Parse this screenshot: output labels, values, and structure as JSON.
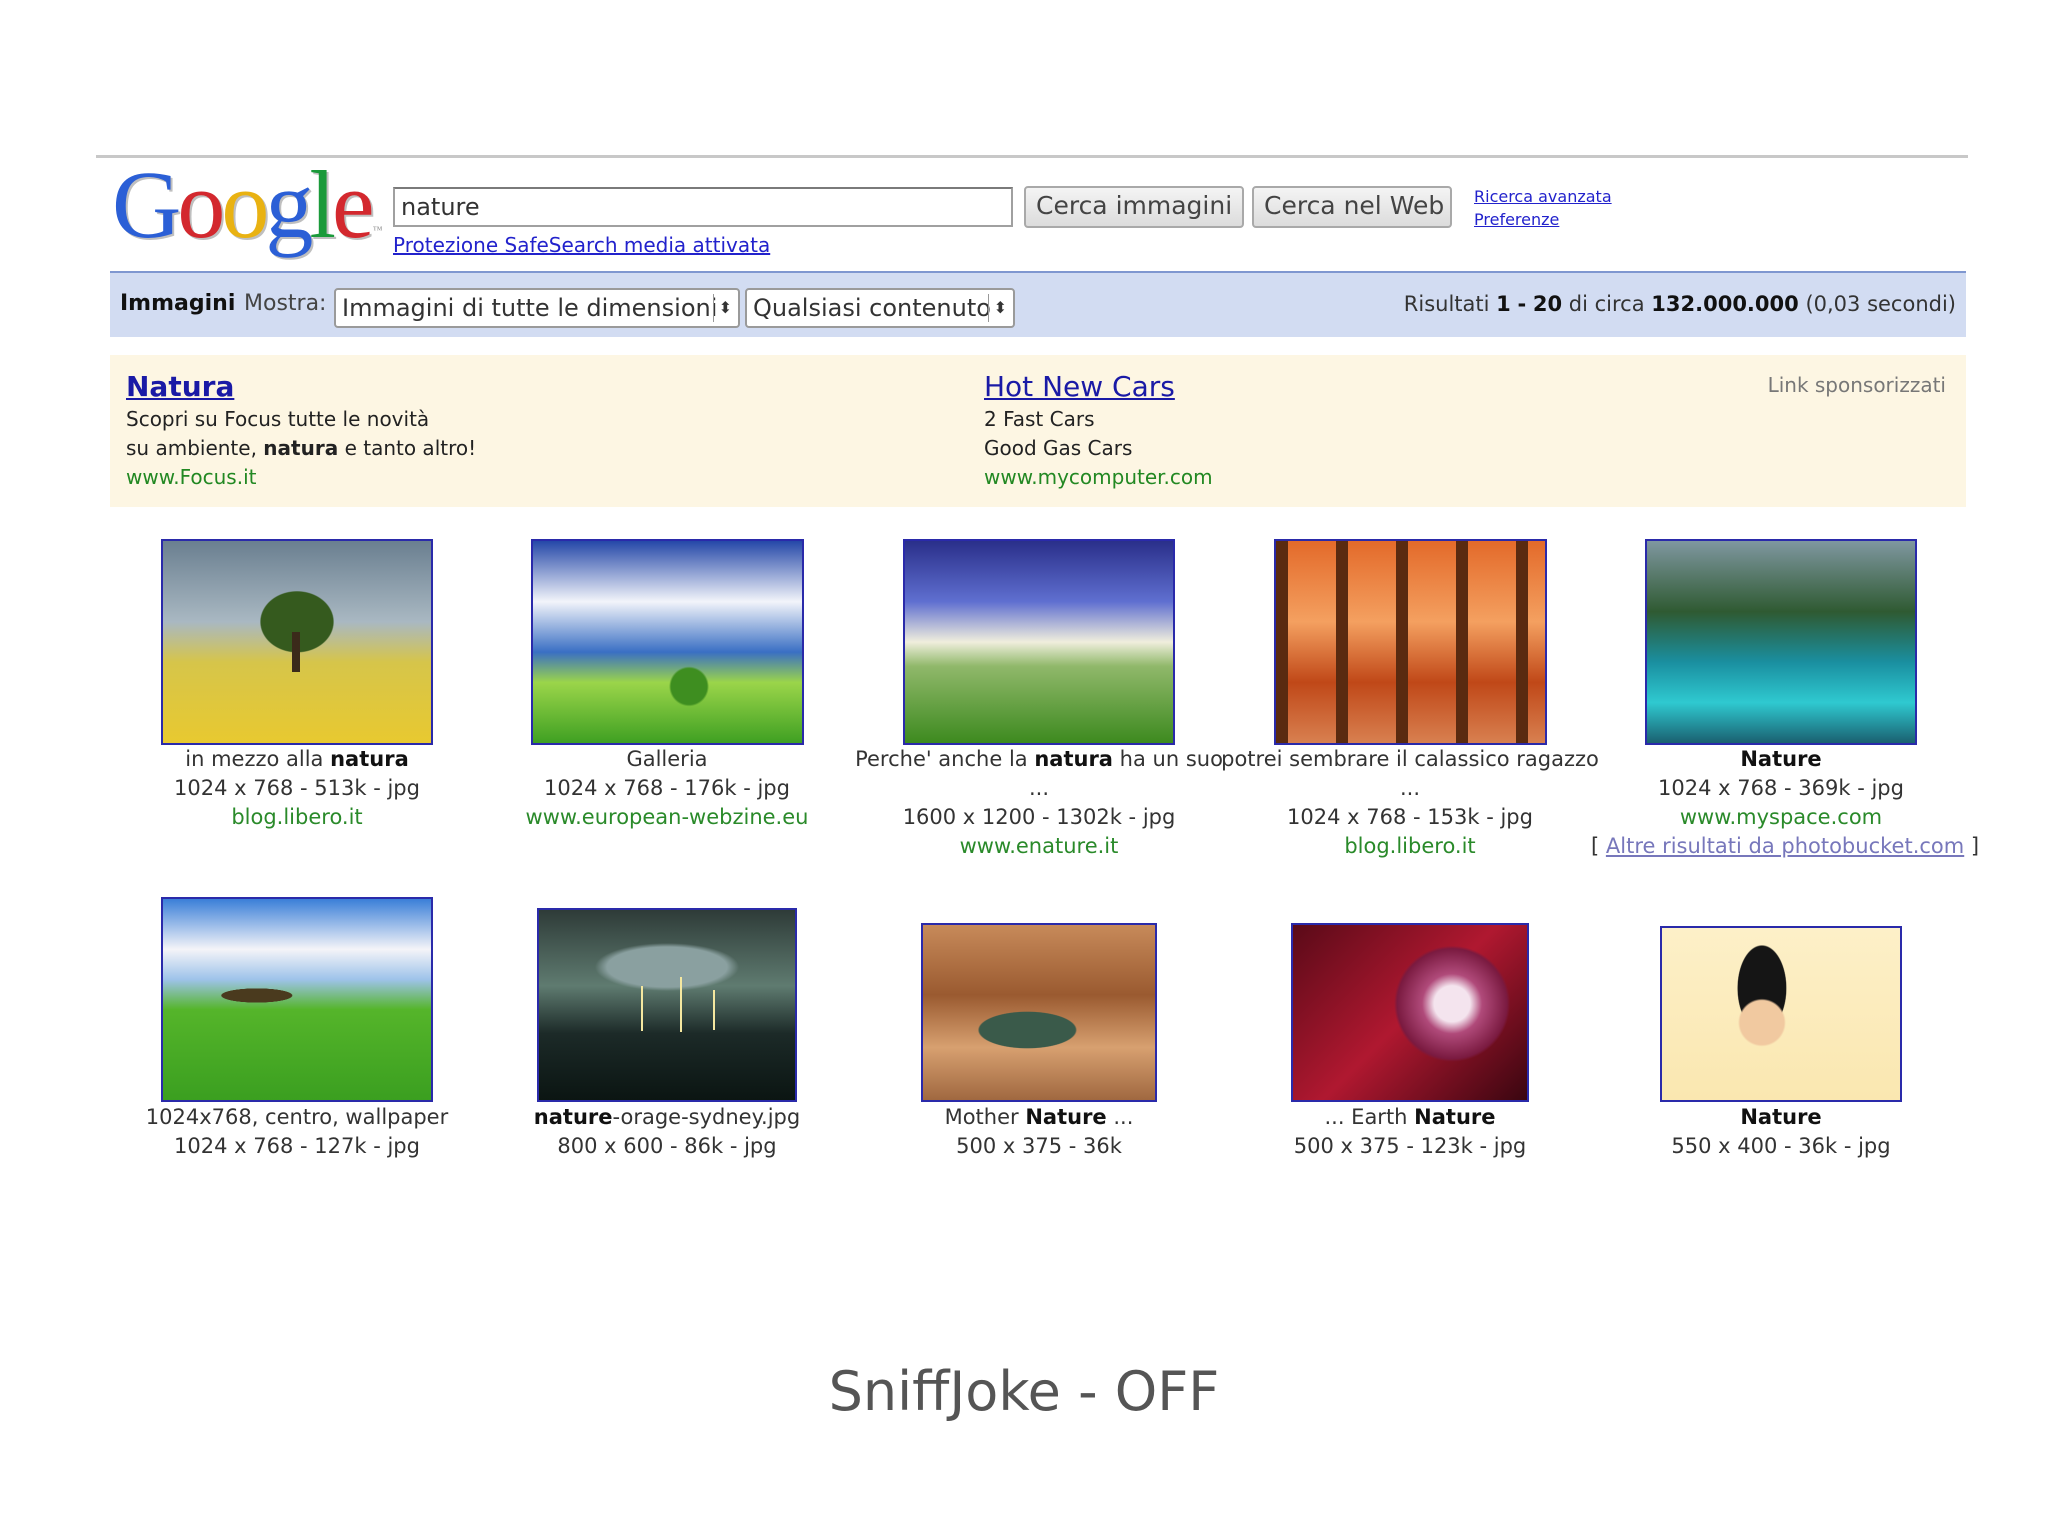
{
  "header": {
    "logo_text": "Google",
    "logo_tm": "™",
    "search_value": "nature",
    "btn_images": "Cerca immagini",
    "btn_web": "Cerca nel Web",
    "advanced_search": "Ricerca avanzata",
    "preferences": "Preferenze",
    "safesearch": "Protezione SafeSearch media attivata"
  },
  "bar": {
    "section": "Immagini",
    "show_label": "Mostra:",
    "size_select": "Immagini di tutte le dimensioni",
    "content_select": "Qualsiasi contenuto",
    "results_prefix": "Risultati",
    "results_from": "1",
    "results_dash": "-",
    "results_to": "20",
    "results_about": "di circa",
    "results_total": "132.000.000",
    "results_time": "(0,03 secondi)"
  },
  "ads": {
    "sponsored_label": "Link sponsorizzati",
    "left": {
      "title": "Natura",
      "line1": "Scopri su Focus tutte le novità",
      "line2_pre": "su ambiente,",
      "line2_bold": "natura",
      "line2_post": "e tanto altro!",
      "url": "www.Focus.it"
    },
    "right": {
      "title": "Hot New Cars",
      "line1": "2 Fast Cars",
      "line2": "Good Gas Cars",
      "url": "www.mycomputer.com"
    }
  },
  "results": [
    {
      "cap_pre": "in mezzo alla",
      "cap_bold": "natura",
      "cap_post": "",
      "cap2": "",
      "meta": "1024 x 768 - 513k - jpg",
      "url": "blog.libero.it"
    },
    {
      "cap_pre": "Galleria",
      "cap_bold": "",
      "cap_post": "",
      "cap2": "",
      "meta": "1024 x 768 - 176k - jpg",
      "url": "www.european-webzine.eu"
    },
    {
      "cap_pre": "Perche' anche la",
      "cap_bold": "natura",
      "cap_post": "ha un suo",
      "cap2": "...",
      "meta": "1600 x 1200 - 1302k - jpg",
      "url": "www.enature.it"
    },
    {
      "cap_pre": "potrei sembrare il calassico ragazzo",
      "cap_bold": "",
      "cap_post": "",
      "cap2": "...",
      "meta": "1024 x 768 - 153k - jpg",
      "url": "blog.libero.it"
    },
    {
      "cap_pre": "",
      "cap_bold": "Nature",
      "cap_post": "",
      "cap2": "",
      "meta": "1024 x 768 - 369k - jpg",
      "url": "www.myspace.com",
      "more_open": "[",
      "more": "Altre risultati da photobucket.com",
      "more_close": "]"
    },
    {
      "cap_pre": "1024x768, centro, wallpaper",
      "cap_bold": "",
      "cap_post": "",
      "meta": "1024 x 768 - 127k - jpg"
    },
    {
      "cap_pre": "",
      "cap_bold": "nature",
      "cap_post": "-orage-sydney.jpg",
      "meta": "800 x 600 - 86k - jpg"
    },
    {
      "cap_pre": "Mother",
      "cap_bold": "Nature",
      "cap_post": "...",
      "meta": "500 x 375 - 36k"
    },
    {
      "cap_pre": "... Earth",
      "cap_bold": "Nature",
      "cap_post": "",
      "meta": "500 x 375 - 123k - jpg"
    },
    {
      "cap_pre": "",
      "cap_bold": "Nature",
      "cap_post": "",
      "meta": "550 x 400 - 36k - jpg"
    }
  ],
  "footer": {
    "title": "SniffJoke - OFF"
  },
  "colors": {
    "link": "#2222cc",
    "url_green": "#228822",
    "bar_bg": "#d2dcf2",
    "ad_bg": "#fdf6e3"
  }
}
